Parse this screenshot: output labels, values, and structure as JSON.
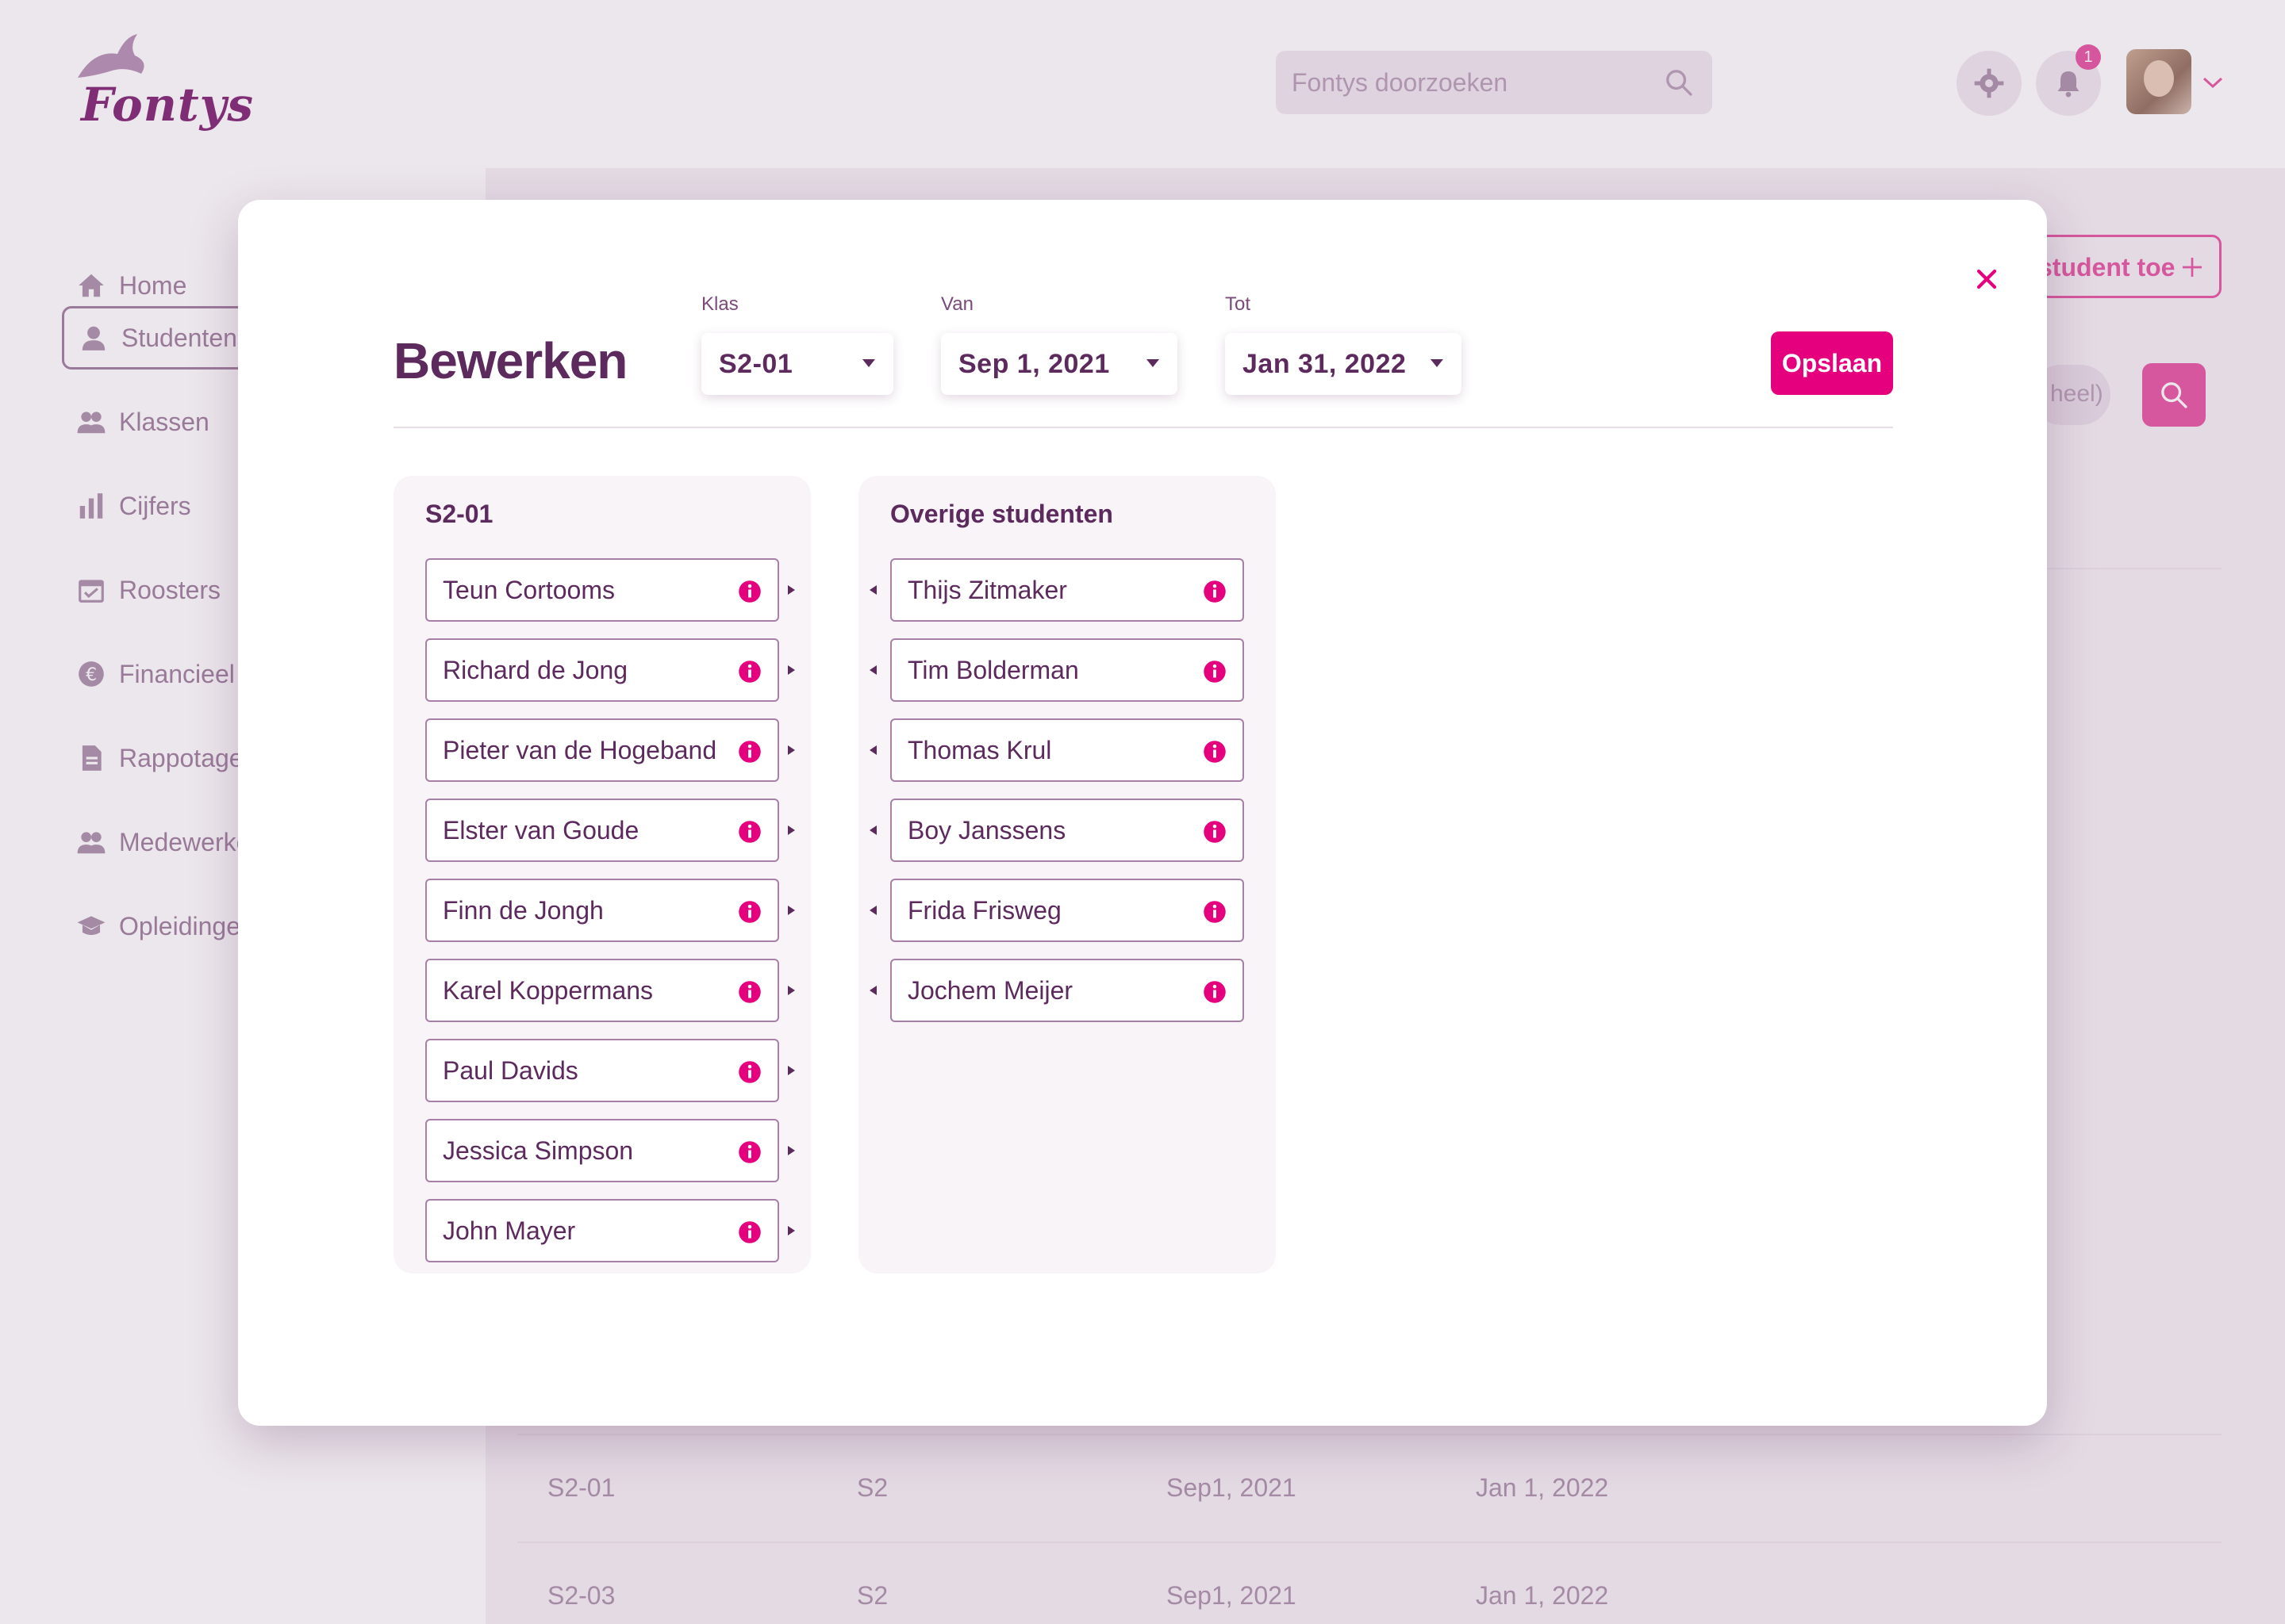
{
  "app": {
    "logo_text": "Fontys",
    "search_placeholder": "Fontys doorzoeken",
    "notification_count": "1",
    "nav": [
      {
        "label": "Home",
        "icon": "home-icon"
      },
      {
        "label": "Studenten",
        "icon": "user-icon",
        "active": true
      },
      {
        "label": "Klassen",
        "icon": "users-icon"
      },
      {
        "label": "Cijfers",
        "icon": "bar-chart-icon"
      },
      {
        "label": "Roosters",
        "icon": "calendar-check-icon"
      },
      {
        "label": "Financieel",
        "icon": "euro-icon"
      },
      {
        "label": "Rappotage",
        "icon": "document-icon"
      },
      {
        "label": "Medewerkers",
        "icon": "users-icon"
      },
      {
        "label": "Opleidingen",
        "icon": "graduation-cap-icon"
      }
    ],
    "add_button_label": "student toe",
    "filter_pill_text": "heel)",
    "table_rows": [
      {
        "klas": "S2-01",
        "jaar": "S2",
        "van": "Sep1, 2021",
        "tot": "Jan 1, 2022"
      },
      {
        "klas": "S2-03",
        "jaar": "S2",
        "van": "Sep1, 2021",
        "tot": "Jan 1, 2022"
      }
    ]
  },
  "modal": {
    "title": "Bewerken",
    "fields": {
      "klas": {
        "label": "Klas",
        "value": "S2-01"
      },
      "van": {
        "label": "Van",
        "value": "Sep 1, 2021"
      },
      "tot": {
        "label": "Tot",
        "value": "Jan 31, 2022"
      }
    },
    "save_label": "Opslaan",
    "class_panel": {
      "title": "S2-01",
      "students": [
        "Teun Cortooms",
        "Richard de Jong",
        "Pieter van de Hogeband",
        "Elster van Goude",
        "Finn de Jongh",
        "Karel Koppermans",
        "Paul Davids",
        "Jessica Simpson",
        "John Mayer"
      ]
    },
    "other_panel": {
      "title": "Overige studenten",
      "students": [
        "Thijs Zitmaker",
        "Tim Bolderman",
        "Thomas Krul",
        "Boy Janssens",
        "Frida Frisweg",
        "Jochem Meijer"
      ]
    }
  },
  "colors": {
    "accent": "#e5007e",
    "text_primary": "#5c2a5c",
    "card_border": "#a77fa7"
  }
}
